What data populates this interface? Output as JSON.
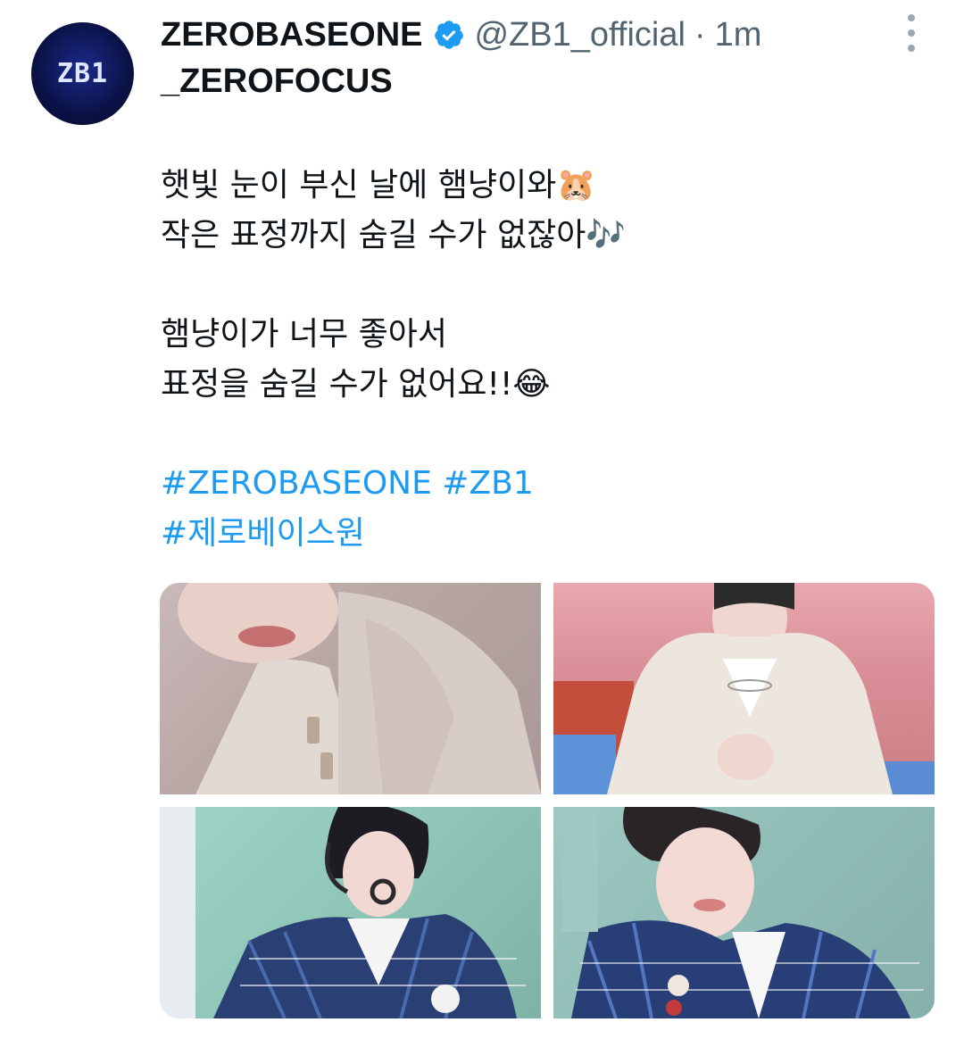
{
  "author": {
    "display_name": "ZEROBASEONE",
    "display_name_line2": "_ZEROFOCUS",
    "handle": "@ZB1_official",
    "separator": "·",
    "time": "1m",
    "avatar_text": "ZB1",
    "verified_icon": "verified-badge-icon"
  },
  "tweet": {
    "lines": [
      "햇빛 눈이 부신 날에 햄냥이와🐹",
      "작은 표정까지 숨길 수가 없잖아🎶",
      "햄냥이가 너무 좋아서",
      "표정을 숨길 수가 없어요!!😂"
    ],
    "hashtags": [
      "#ZEROBASEONE #ZB1",
      "#제로베이스원"
    ]
  },
  "media": {
    "photos": [
      {
        "name": "photo-1"
      },
      {
        "name": "photo-2"
      },
      {
        "name": "photo-3"
      },
      {
        "name": "photo-4"
      }
    ]
  },
  "colors": {
    "link": "#1d9bf0",
    "secondary_text": "#536471",
    "verified": "#1d9bf0"
  },
  "icons": {
    "more": "more-options-icon"
  }
}
